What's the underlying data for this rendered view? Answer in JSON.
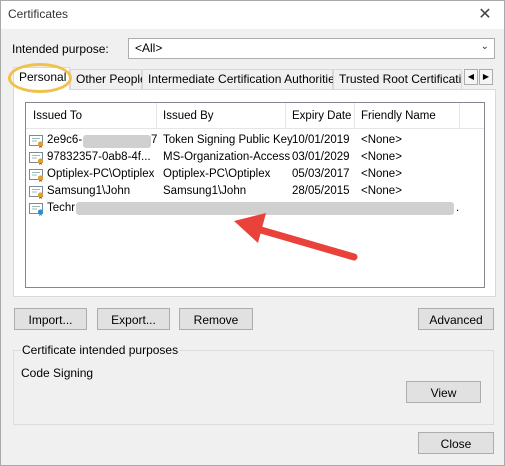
{
  "window": {
    "title": "Certificates",
    "close_glyph": "✕"
  },
  "purpose": {
    "label": "Intended purpose:",
    "value": "<All>"
  },
  "tabs": [
    {
      "label": "Personal",
      "active": true
    },
    {
      "label": "Other People"
    },
    {
      "label": "Intermediate Certification Authorities"
    },
    {
      "label": "Trusted Root Certification"
    }
  ],
  "list": {
    "columns": [
      "Issued To",
      "Issued By",
      "Expiry Date",
      "Friendly Name"
    ],
    "rows": [
      {
        "issued_to": "2e9c6-",
        "issued_to_tail": "7",
        "issued_by": "Token Signing Public Key",
        "expiry": "10/01/2019",
        "friendly": "<None>"
      },
      {
        "issued_to": "97832357-0ab8-4f...",
        "issued_by": "MS-Organization-Access",
        "expiry": "03/01/2029",
        "friendly": "<None>"
      },
      {
        "issued_to": "Optiplex-PC\\Optiplex",
        "issued_by": "Optiplex-PC\\Optiplex",
        "expiry": "05/03/2017",
        "friendly": "<None>"
      },
      {
        "issued_to": "Samsung1\\John",
        "issued_by": "Samsung1\\John",
        "expiry": "28/05/2015",
        "friendly": "<None>"
      },
      {
        "issued_to": "Techr",
        "issued_by": "",
        "expiry": "",
        "friendly": "",
        "tail": "."
      }
    ]
  },
  "buttons": {
    "import": "Import...",
    "export": "Export...",
    "remove": "Remove",
    "advanced": "Advanced",
    "view": "View",
    "close": "Close"
  },
  "purposes_group": {
    "title": "Certificate intended purposes",
    "value": "Code Signing"
  },
  "colors": {
    "callout": "#f0c24b",
    "arrow": "#e8423a"
  }
}
